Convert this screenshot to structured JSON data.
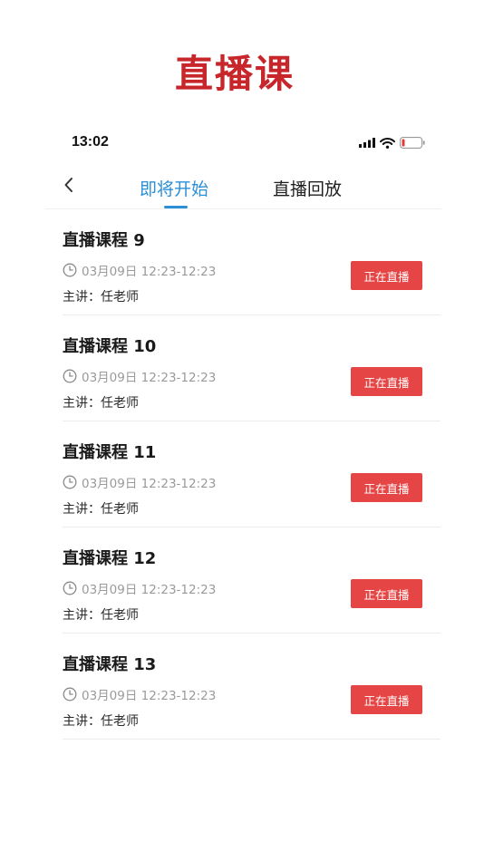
{
  "banner": {
    "title": "直播课"
  },
  "status_bar": {
    "time": "13:02"
  },
  "nav": {
    "tabs": [
      {
        "label": "即将开始",
        "active": true
      },
      {
        "label": "直播回放",
        "active": false
      }
    ]
  },
  "colors": {
    "accent": "#2b8fd8",
    "live_button": "#e64545",
    "banner": "#c7262b"
  },
  "courses": [
    {
      "title": "直播课程 9",
      "time": "03月09日 12:23-12:23",
      "teacher": "主讲：任老师",
      "action": "正在直播"
    },
    {
      "title": "直播课程 10",
      "time": "03月09日 12:23-12:23",
      "teacher": "主讲：任老师",
      "action": "正在直播"
    },
    {
      "title": "直播课程 11",
      "time": "03月09日 12:23-12:23",
      "teacher": "主讲：任老师",
      "action": "正在直播"
    },
    {
      "title": "直播课程 12",
      "time": "03月09日 12:23-12:23",
      "teacher": "主讲：任老师",
      "action": "正在直播"
    },
    {
      "title": "直播课程 13",
      "time": "03月09日 12:23-12:23",
      "teacher": "主讲：任老师",
      "action": "正在直播"
    }
  ]
}
